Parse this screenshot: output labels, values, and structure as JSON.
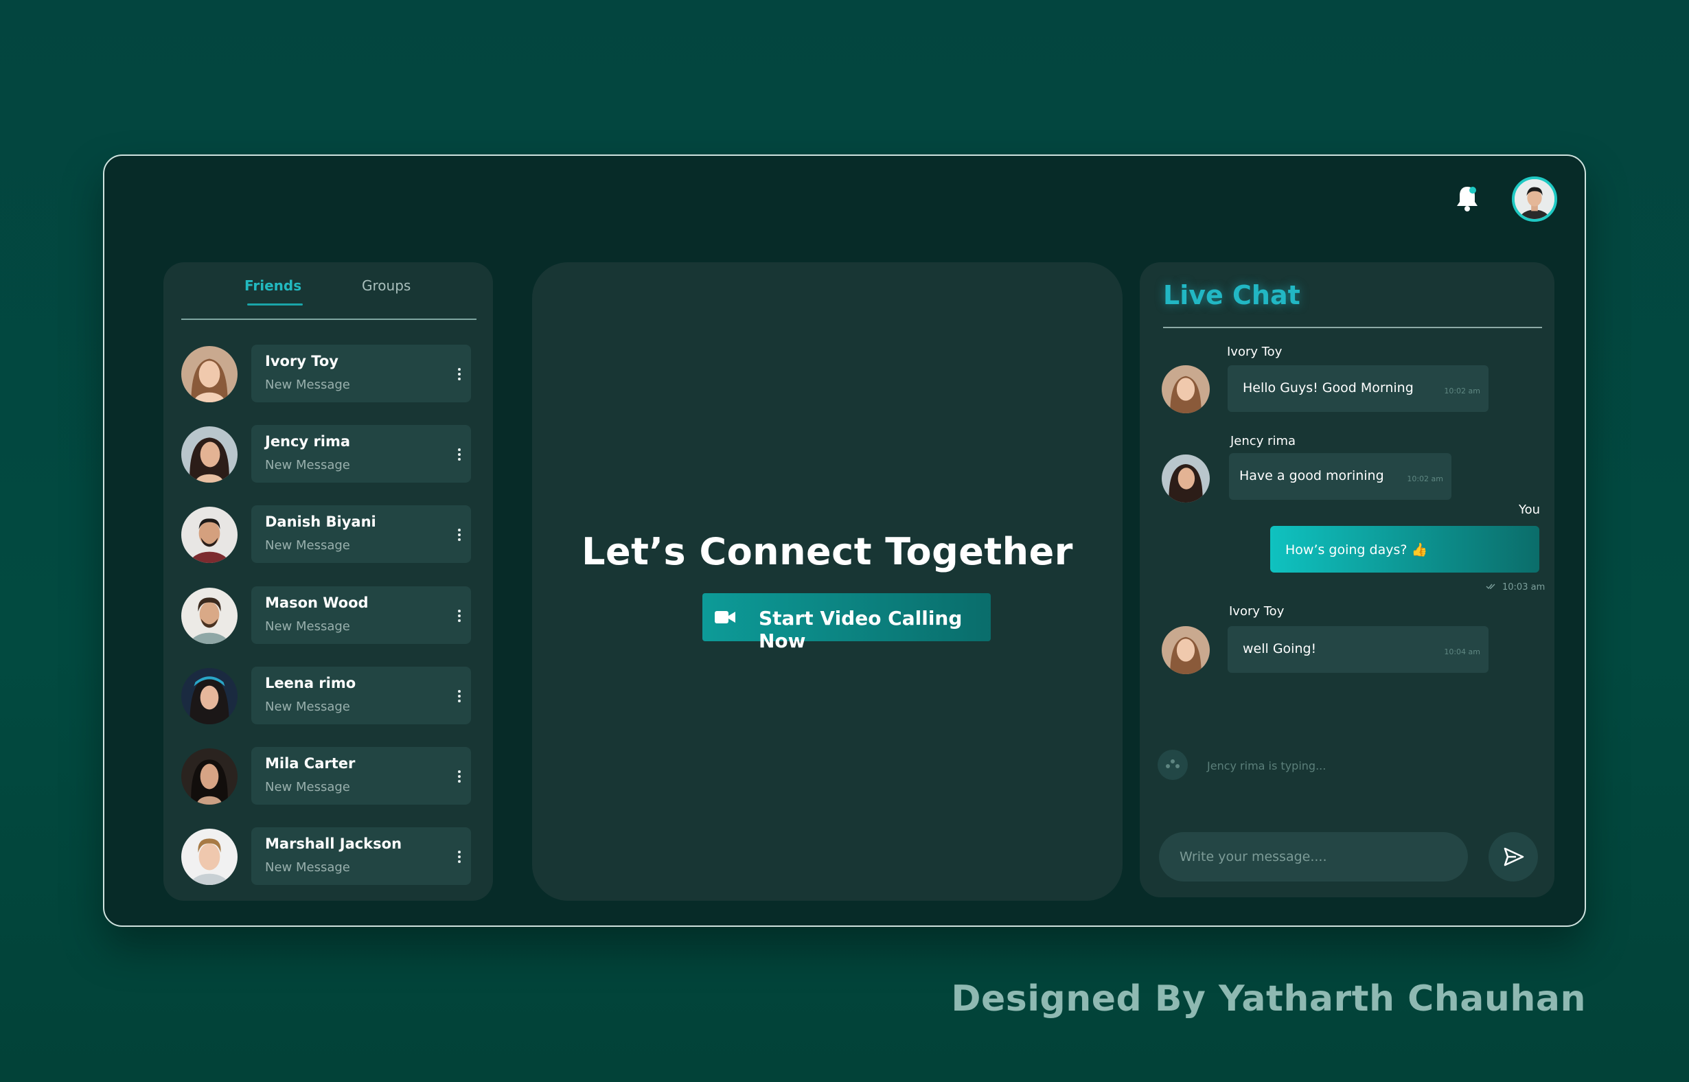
{
  "header": {
    "notification_icon": "bell-icon",
    "profile_avatar": "user-avatar"
  },
  "friends_panel": {
    "tabs": [
      {
        "label": "Friends",
        "active": true
      },
      {
        "label": "Groups",
        "active": false
      }
    ],
    "friends": [
      {
        "name": "Ivory Toy",
        "status": "New Message"
      },
      {
        "name": "Jency rima",
        "status": "New Message"
      },
      {
        "name": "Danish Biyani",
        "status": "New Message"
      },
      {
        "name": "Mason Wood",
        "status": "New Message"
      },
      {
        "name": "Leena rimo",
        "status": "New Message"
      },
      {
        "name": "Mila Carter",
        "status": "New Message"
      },
      {
        "name": "Marshall Jackson",
        "status": "New Message"
      }
    ]
  },
  "video_panel": {
    "title": "Let’s Connect Together",
    "call_button_label": "Start Video Calling Now",
    "call_icon": "video-camera-icon"
  },
  "chat_panel": {
    "title": "Live Chat",
    "messages": [
      {
        "sender": "Ivory Toy",
        "text": "Hello Guys!  Good Morning",
        "time": "10:02 am"
      },
      {
        "sender": "Jency rima",
        "text": "Have a good morining",
        "time": "10:02 am"
      },
      {
        "sender": "You",
        "text": "How’s going days? 👍",
        "time": "10:03 am"
      },
      {
        "sender": "Ivory Toy",
        "text": "well Going!",
        "time": "10:04 am"
      }
    ],
    "typing_indicator": "Jency rima is typing...",
    "input_placeholder": "Write your message....",
    "send_icon": "send-icon"
  },
  "credit": "Designed By Yatharth Chauhan",
  "colors": {
    "background": "#03453f",
    "frame": "#072b28",
    "panel": "#183634",
    "card": "#224543",
    "accent": "#22b7c4",
    "button": "#0d9b98"
  }
}
